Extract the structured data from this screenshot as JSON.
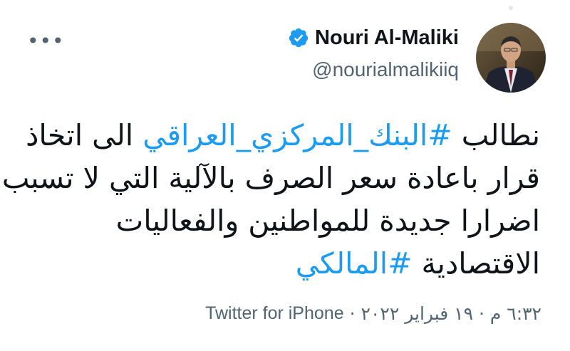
{
  "author": {
    "name": "Nouri Al-Maliki",
    "handle": "@nourialmalikiiq",
    "verified": true,
    "avatar_icon": "profile-photo"
  },
  "menu": {
    "more_label": "•••"
  },
  "tweet": {
    "lines": [
      {
        "before": "نطالب ",
        "hashtag": "#البنك_المركزي_العراقي",
        "after": " الى اتخاذ"
      },
      {
        "text": "قرار باعادة سعر الصرف بالآلية التي لا تسبب"
      },
      {
        "text": "اضرارا جديدة للمواطنين والفعاليات"
      },
      {
        "before": "الاقتصادية ",
        "hashtag": "#المالكي",
        "after": ""
      }
    ]
  },
  "meta": {
    "timestamp": "٦:٣٢ م · ١٩ فبراير ٢٠٢٢",
    "separator": "·",
    "source": "Twitter for iPhone"
  },
  "colors": {
    "accent": "#1d9bf0",
    "text": "#0f1419",
    "secondary": "#536471"
  }
}
